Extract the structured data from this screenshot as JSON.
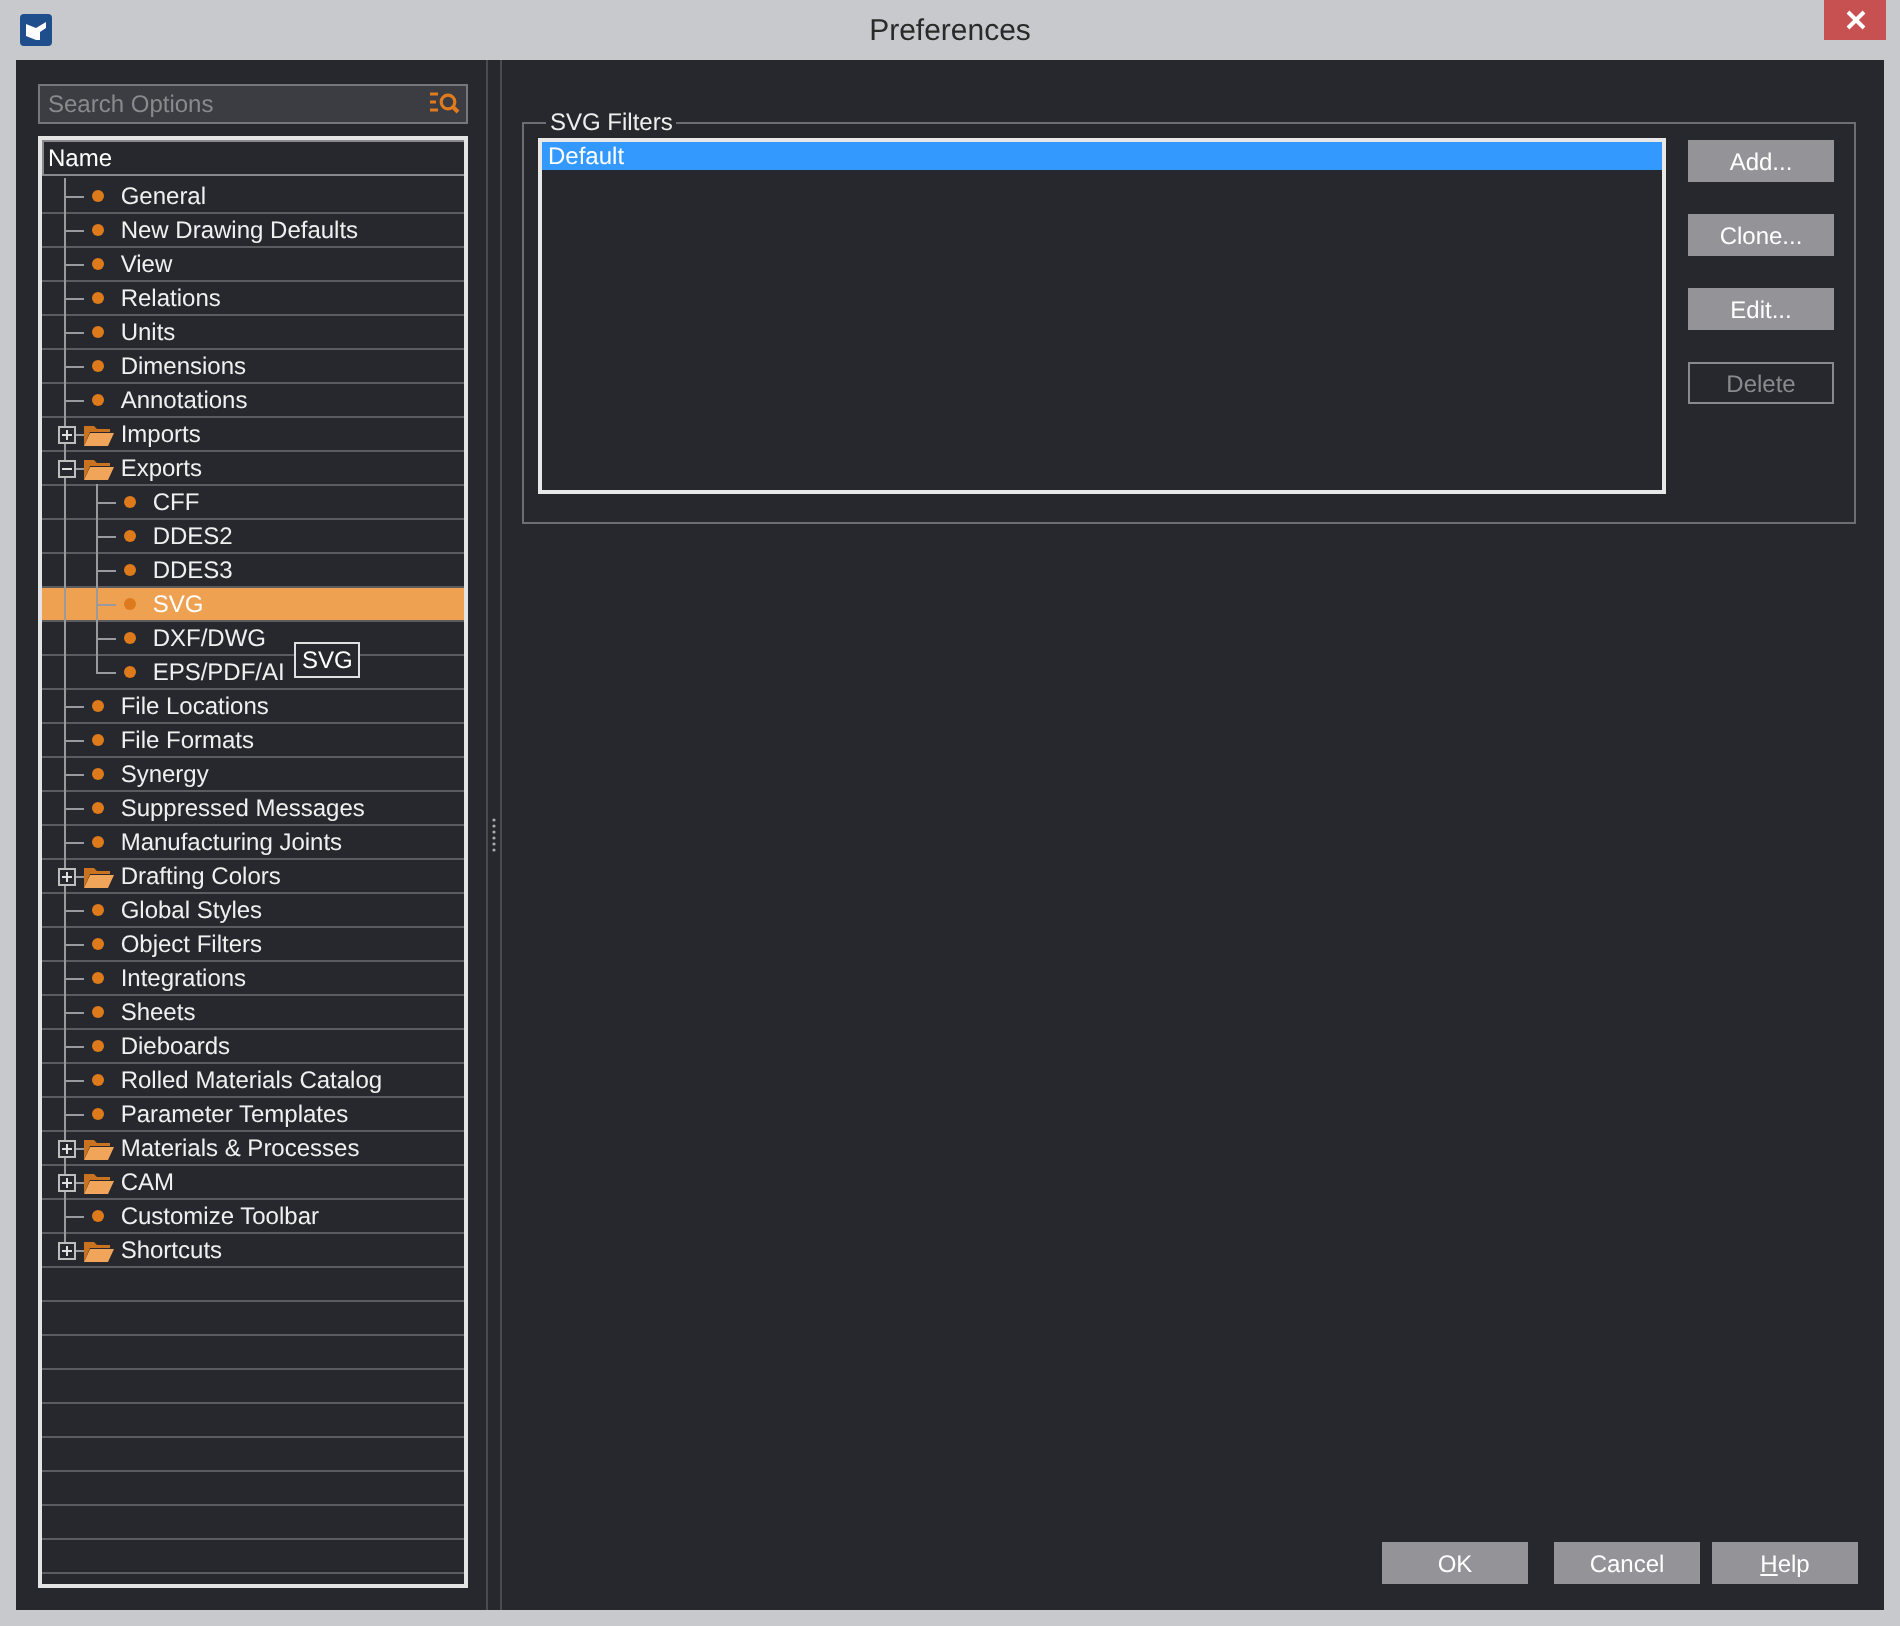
{
  "window": {
    "title": "Preferences"
  },
  "search": {
    "placeholder": "Search Options"
  },
  "tree": {
    "column": "Name",
    "items": [
      {
        "kind": "leaf",
        "label": "General",
        "selected": false
      },
      {
        "kind": "leaf",
        "label": "New Drawing Defaults",
        "selected": false
      },
      {
        "kind": "leaf",
        "label": "View",
        "selected": false
      },
      {
        "kind": "leaf",
        "label": "Relations",
        "selected": false
      },
      {
        "kind": "leaf",
        "label": "Units",
        "selected": false
      },
      {
        "kind": "leaf",
        "label": "Dimensions",
        "selected": false
      },
      {
        "kind": "leaf",
        "label": "Annotations",
        "selected": false
      },
      {
        "kind": "folder",
        "label": "Imports",
        "selected": false,
        "expanded": false
      },
      {
        "kind": "folder",
        "label": "Exports",
        "selected": false,
        "expanded": true,
        "children": [
          {
            "kind": "leaf",
            "label": "CFF",
            "selected": false
          },
          {
            "kind": "leaf",
            "label": "DDES2",
            "selected": false
          },
          {
            "kind": "leaf",
            "label": "DDES3",
            "selected": false
          },
          {
            "kind": "leaf",
            "label": "SVG",
            "selected": true
          },
          {
            "kind": "leaf",
            "label": "DXF/DWG",
            "selected": false
          },
          {
            "kind": "leaf",
            "label": "EPS/PDF/AI",
            "selected": false
          }
        ]
      },
      {
        "kind": "leaf",
        "label": "File Locations",
        "selected": false
      },
      {
        "kind": "leaf",
        "label": "File Formats",
        "selected": false
      },
      {
        "kind": "leaf",
        "label": "Synergy",
        "selected": false
      },
      {
        "kind": "leaf",
        "label": "Suppressed Messages",
        "selected": false
      },
      {
        "kind": "leaf",
        "label": "Manufacturing Joints",
        "selected": false
      },
      {
        "kind": "folder",
        "label": "Drafting Colors",
        "selected": false,
        "expanded": false
      },
      {
        "kind": "leaf",
        "label": "Global Styles",
        "selected": false
      },
      {
        "kind": "leaf",
        "label": "Object Filters",
        "selected": false
      },
      {
        "kind": "leaf",
        "label": "Integrations",
        "selected": false
      },
      {
        "kind": "leaf",
        "label": "Sheets",
        "selected": false
      },
      {
        "kind": "leaf",
        "label": "Dieboards",
        "selected": false
      },
      {
        "kind": "leaf",
        "label": "Rolled Materials Catalog",
        "selected": false
      },
      {
        "kind": "leaf",
        "label": "Parameter Templates",
        "selected": false
      },
      {
        "kind": "folder",
        "label": "Materials & Processes",
        "selected": false,
        "expanded": false
      },
      {
        "kind": "folder",
        "label": "CAM",
        "selected": false,
        "expanded": false
      },
      {
        "kind": "leaf",
        "label": "Customize Toolbar",
        "selected": false
      },
      {
        "kind": "folder",
        "label": "Shortcuts",
        "selected": false,
        "expanded": false
      }
    ]
  },
  "tooltip": {
    "text": "SVG"
  },
  "group": {
    "title": "SVG Filters",
    "filters": [
      {
        "label": "Default",
        "selected": true
      }
    ],
    "buttons": [
      {
        "label": "Add...",
        "disabled": false
      },
      {
        "label": "Clone...",
        "disabled": false
      },
      {
        "label": "Edit...",
        "disabled": false
      },
      {
        "label": "Delete",
        "disabled": true
      }
    ]
  },
  "footer_buttons": [
    {
      "label": "OK",
      "mnemonic": false
    },
    {
      "label": "Cancel",
      "mnemonic": false
    },
    {
      "label": "Help",
      "mnemonic": true
    }
  ]
}
